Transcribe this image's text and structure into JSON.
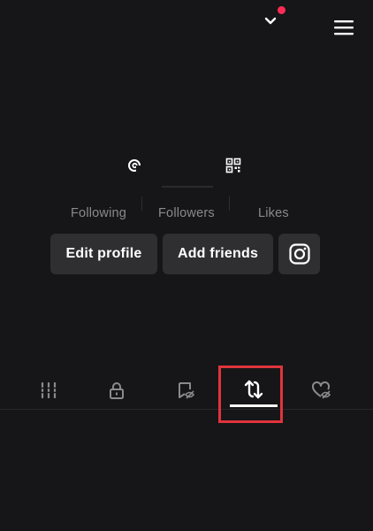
{
  "profile": {
    "stats": {
      "following_label": "Following",
      "followers_label": "Followers",
      "likes_label": "Likes"
    },
    "buttons": {
      "edit_profile": "Edit profile",
      "add_friends": "Add friends"
    }
  },
  "top_bar": {
    "account_switch_icon": "chevron-down-icon",
    "notification_dot_color": "#fe2c55",
    "menu_icon": "hamburger-menu-icon"
  },
  "tabs": [
    {
      "icon": "grid-icon",
      "active": false
    },
    {
      "icon": "lock-icon",
      "active": false
    },
    {
      "icon": "bookmark-eye-icon",
      "active": false
    },
    {
      "icon": "repost-icon",
      "active": true
    },
    {
      "icon": "heart-eye-icon",
      "active": false
    }
  ],
  "colors": {
    "background": "#161618",
    "button_bg": "#2f2f31",
    "label_gray": "#8a8a8c",
    "highlight": "#e0343c"
  }
}
